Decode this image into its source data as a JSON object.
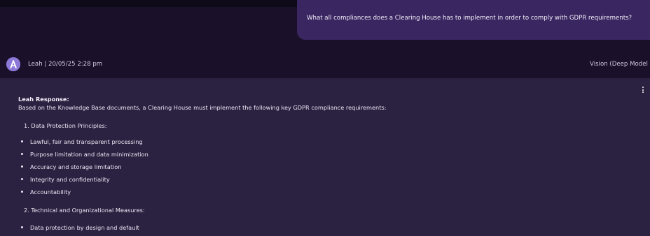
{
  "user_message": "What all compliances does a Clearing House has to implement in order to comply with GDPR requirements?",
  "agent": {
    "avatar_icon": "assistant-logo-icon",
    "meta": "Leah | 20/05/25 2:28 pm",
    "model": "Vision (Deep Model"
  },
  "response": {
    "title": "Leah Response:",
    "intro": "Based on the Knowledge Base documents, a Clearing House must implement the following key GDPR compliance requirements:",
    "sections": [
      {
        "heading": "1. Data Protection Principles:",
        "items": [
          "Lawful, fair and transparent processing",
          "Purpose limitation and data minimization",
          "Accuracy and storage limitation",
          "Integrity and confidentiality",
          "Accountability"
        ]
      },
      {
        "heading": "2. Technical and Organizational Measures:",
        "items": [
          "Data protection by design and default"
        ]
      }
    ]
  },
  "colors": {
    "background": "#1b1029",
    "user_bubble": "#3a2660",
    "response_panel": "#2b2140",
    "avatar": "#8b78d8"
  }
}
